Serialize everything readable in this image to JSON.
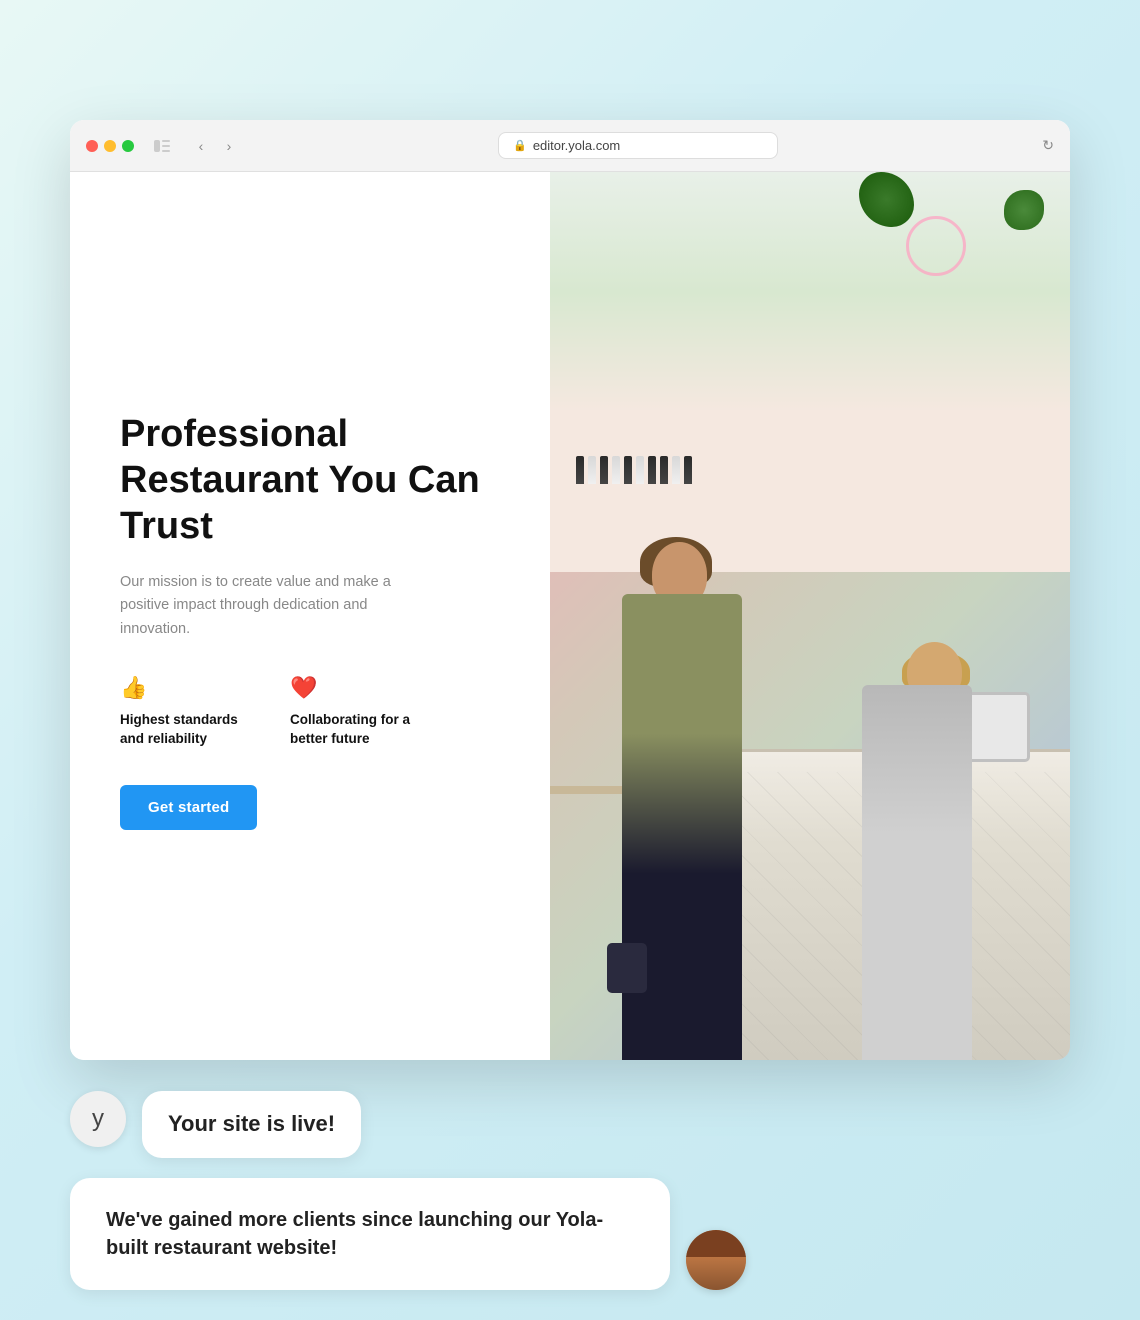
{
  "browser": {
    "url": "editor.yola.com",
    "traffic_lights": {
      "red": "#ff5f56",
      "yellow": "#ffbd2e",
      "green": "#27c93f"
    }
  },
  "hero": {
    "heading": "Professional Restaurant You Can Trust",
    "description": "Our mission is to create value and make a positive impact through dedication and innovation.",
    "features": [
      {
        "icon": "👍",
        "label": "Highest standards and reliability"
      },
      {
        "icon": "❤️",
        "label": "Collaborating for a better future"
      }
    ],
    "cta_label": "Get started"
  },
  "chat": {
    "yola_logo": "y",
    "bubble1_text": "Your site is live!",
    "bubble2_text": "We've gained more clients since launching our Yola-built restaurant website!"
  }
}
